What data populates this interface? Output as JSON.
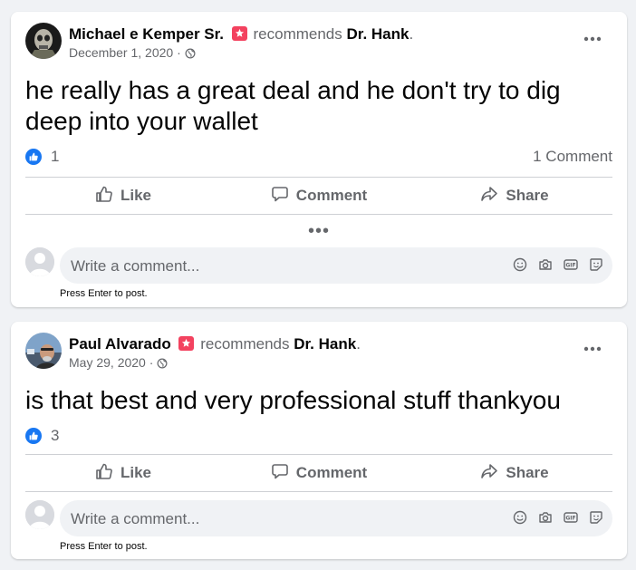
{
  "posts": [
    {
      "author": "Michael e Kemper Sr.",
      "action": "recommends",
      "page": "Dr. Hank",
      "page_suffix": ".",
      "date": "December 1, 2020 ·",
      "text": "he really has a great deal and he don't try to dig deep into your wallet",
      "like_count": "1",
      "comment_count": "1 Comment",
      "more_comments": "•••",
      "comment_placeholder": "Write a comment...",
      "hint": "Press Enter to post."
    },
    {
      "author": "Paul Alvarado",
      "action": "recommends",
      "page": "Dr. Hank",
      "page_suffix": ".",
      "date": "May 29, 2020 ·",
      "text": "is that best and very professional stuff thankyou",
      "like_count": "3",
      "comment_placeholder": "Write a comment...",
      "hint": "Press Enter to post."
    }
  ],
  "actions": {
    "like": "Like",
    "comment": "Comment",
    "share": "Share"
  },
  "icons": {
    "recommend": "recommend-star-icon",
    "privacy": "globe-icon",
    "more": "more-options-icon",
    "like_reaction": "like-thumb-icon",
    "emoji": "emoji-icon",
    "camera": "camera-icon",
    "gif": "gif-icon",
    "sticker": "sticker-icon"
  },
  "colors": {
    "accent": "#1877f2",
    "recommend_badge": "#f3425f",
    "secondary_text": "#65676b"
  }
}
